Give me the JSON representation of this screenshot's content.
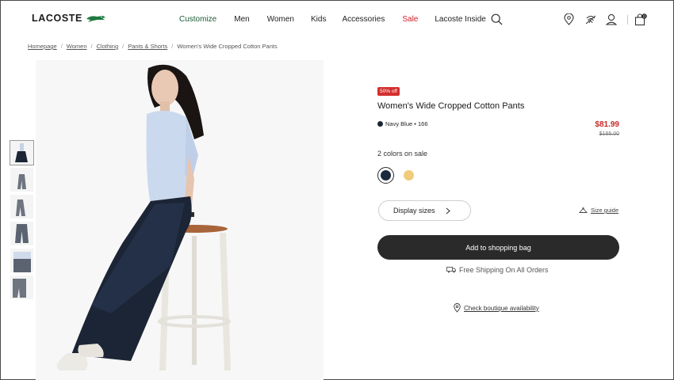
{
  "brand": {
    "name": "LACOSTE",
    "logo_icon": "crocodile-icon"
  },
  "nav": {
    "items": [
      "Customize",
      "Men",
      "Women",
      "Kids",
      "Accessories",
      "Sale",
      "Lacoste Inside"
    ],
    "accent_color": "#1f5c3a",
    "sale_color": "#d0202a"
  },
  "header_icons": [
    "search-icon",
    "store-locator-icon",
    "fingerprint-icon",
    "account-icon",
    "shopping-bag-icon"
  ],
  "cart_count": "0",
  "breadcrumb": [
    "Homepage",
    "Women",
    "Clothing",
    "Pants & Shorts",
    "Women's Wide Cropped Cotton Pants"
  ],
  "gallery": {
    "thumbnail_count": 6,
    "active_index": 0
  },
  "product": {
    "badge": "50% off",
    "title": "Women's Wide Cropped Cotton Pants",
    "color_name": "Navy Blue • 166",
    "price": "$81.99",
    "old_price": "$165.00",
    "colors_label": "2 colors on sale",
    "swatches": [
      {
        "name": "navy",
        "color": "#1c2a3e",
        "selected": true
      },
      {
        "name": "yellow",
        "color": "#f0cc7a",
        "selected": false
      }
    ],
    "sizes_button": "Display sizes",
    "size_guide": "Size guide",
    "add_to_bag": "Add to shopping bag",
    "shipping": "Free Shipping On All Orders",
    "boutique": "Check boutique availability"
  }
}
